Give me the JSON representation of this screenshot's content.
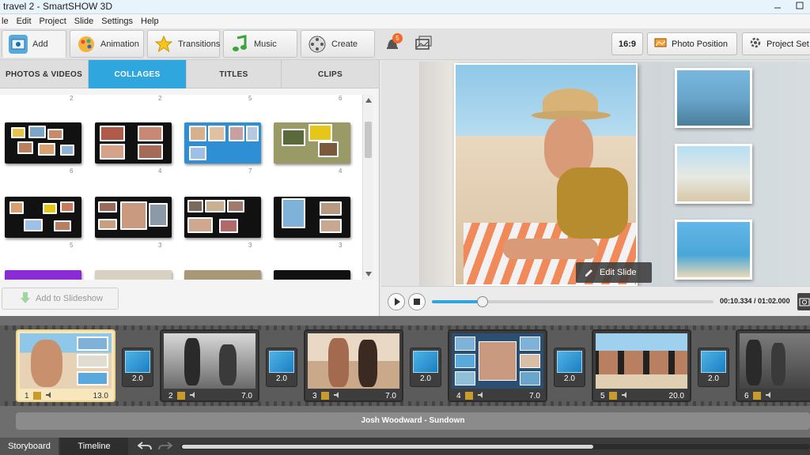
{
  "window": {
    "title": "travel 2 - SmartSHOW 3D"
  },
  "menu": [
    "le",
    "Edit",
    "Project",
    "Slide",
    "Settings",
    "Help"
  ],
  "toolbar": {
    "tabs": [
      {
        "label": "Add",
        "icon": "add-media-icon"
      },
      {
        "label": "Animation",
        "icon": "animation-palette-icon"
      },
      {
        "label": "Transitions",
        "icon": "star-icon"
      },
      {
        "label": "Music",
        "icon": "music-note-icon"
      },
      {
        "label": "Create",
        "icon": "film-reel-icon"
      }
    ],
    "notification_count": "5",
    "aspect_ratio": "16:9",
    "photo_position": "Photo Position",
    "project_settings": "Project Set"
  },
  "library": {
    "tabs": [
      "PHOTOS & VIDEOS",
      "COLLAGES",
      "TITLES",
      "CLIPS"
    ],
    "active_tab": "COLLAGES",
    "top_counts": [
      "2",
      "2",
      "5",
      "6"
    ],
    "row1_counts": [
      "6",
      "4",
      "7",
      "4"
    ],
    "row2_counts": [
      "5",
      "3",
      "3",
      "3"
    ],
    "add_button": "Add to Slideshow"
  },
  "preview": {
    "edit_slide": "Edit Slide"
  },
  "player": {
    "time": "00:10.334 / 01:02.000",
    "progress": 0.18
  },
  "storyboard": {
    "slides": [
      {
        "num": "1",
        "duration": "13.0"
      },
      {
        "num": "2",
        "duration": "7.0"
      },
      {
        "num": "3",
        "duration": "7.0"
      },
      {
        "num": "4",
        "duration": "7.0"
      },
      {
        "num": "5",
        "duration": "20.0"
      },
      {
        "num": "6",
        "duration": ""
      }
    ],
    "transitions": [
      "2.0",
      "2.0",
      "2.0",
      "2.0",
      "2.0"
    ],
    "music": "Josh Woodward - Sundown"
  },
  "bottom": {
    "storyboard": "Storyboard",
    "timeline": "Timeline"
  },
  "colors": {
    "accent": "#2fa6dd",
    "selected": "#f0d38a"
  }
}
